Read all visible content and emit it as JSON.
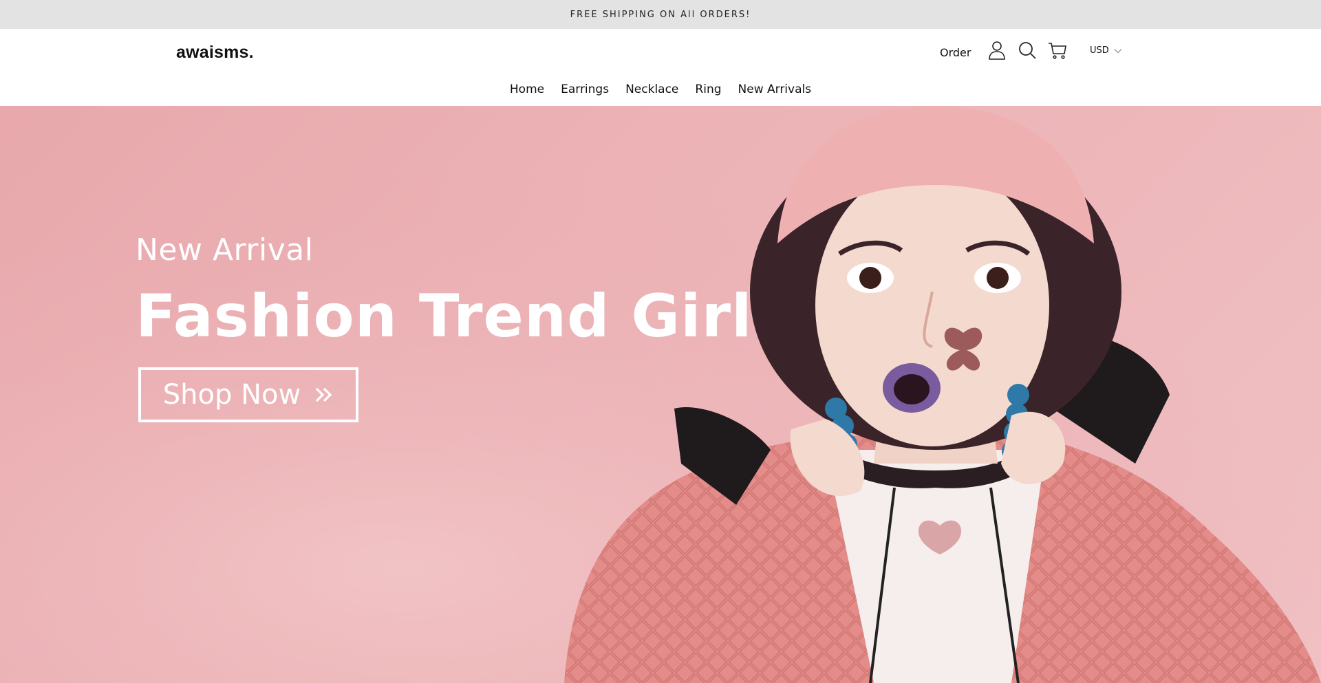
{
  "announcement": {
    "text": "FREE SHIPPING ON All ORDERS!"
  },
  "header": {
    "logo": "awaisms.",
    "order_label": "Order",
    "currency": {
      "selected": "USD"
    },
    "icons": [
      "account-icon",
      "search-icon",
      "cart-icon",
      "chevron-down-icon"
    ]
  },
  "nav": {
    "items": [
      {
        "label": "Home"
      },
      {
        "label": "Earrings"
      },
      {
        "label": "Necklace"
      },
      {
        "label": "Ring"
      },
      {
        "label": "New Arrivals"
      }
    ]
  },
  "hero": {
    "eyebrow": "New Arrival",
    "title": "Fashion Trend Girl",
    "button_label": "Shop Now",
    "colors": {
      "background": "#ecb3b6",
      "jacket": "#e58f8c",
      "beanie": "#efb0b2",
      "text": "#ffffff"
    }
  }
}
